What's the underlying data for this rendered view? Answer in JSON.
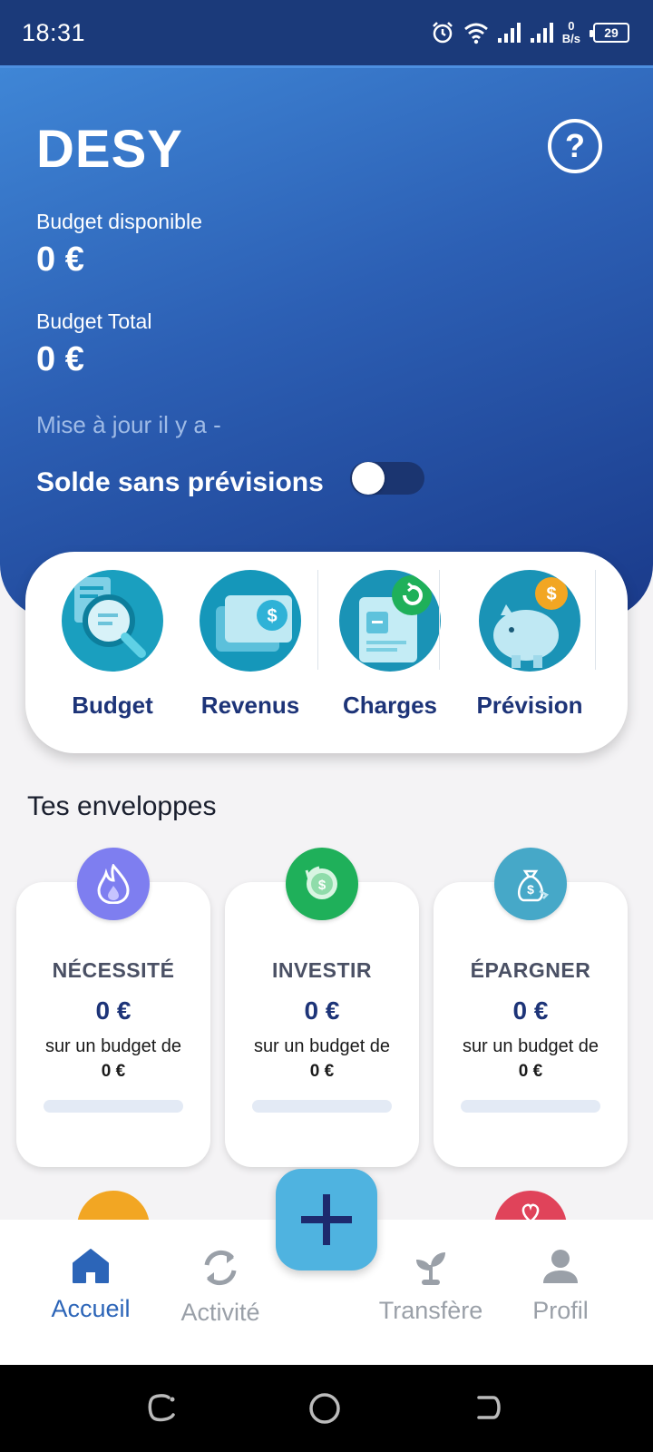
{
  "status_bar": {
    "time": "18:31",
    "net_speed_value": "0",
    "net_speed_unit": "B/s",
    "battery": "29",
    "icons": [
      "alarm-icon",
      "wifi-icon",
      "signal-icon",
      "signal-icon",
      "battery-icon"
    ]
  },
  "header": {
    "user_name": "DESY",
    "help_label": "?",
    "available_label": "Budget disponible",
    "available_value": "0 €",
    "total_label": "Budget Total",
    "total_value": "0 €",
    "update_text": "Mise à jour il y a -",
    "toggle_label": "Solde sans prévisions",
    "toggle_on": false
  },
  "quick_actions": [
    {
      "label": "Budget",
      "icon": "budget-search-icon"
    },
    {
      "label": "Revenus",
      "icon": "income-money-icon"
    },
    {
      "label": "Charges",
      "icon": "charges-document-icon"
    },
    {
      "label": "Prévision",
      "icon": "piggy-bank-icon"
    }
  ],
  "envelopes": {
    "title": "Tes enveloppes",
    "items": [
      {
        "name": "NÉCESSITÉ",
        "amount": "0 €",
        "subtitle": "sur un budget de",
        "budget": "0 €",
        "progress": 0,
        "color": "#7e7ef0",
        "icon": "flame-icon"
      },
      {
        "name": "INVESTIR",
        "amount": "0 €",
        "subtitle": "sur un budget de",
        "budget": "0 €",
        "progress": 0,
        "color": "#1fb05a",
        "icon": "coin-refresh-icon"
      },
      {
        "name": "ÉPARGNER",
        "amount": "0 €",
        "subtitle": "sur un budget de",
        "budget": "0 €",
        "progress": 0,
        "color": "#46a8c8",
        "icon": "money-bag-icon"
      }
    ]
  },
  "bottom_nav": {
    "items": [
      {
        "label": "Accueil",
        "icon": "home-icon",
        "active": true
      },
      {
        "label": "Activité",
        "icon": "sync-icon",
        "active": false
      },
      {
        "label": "Transfère",
        "icon": "sprout-icon",
        "active": false
      },
      {
        "label": "Profil",
        "icon": "person-icon",
        "active": false
      }
    ],
    "fab_icon": "plus-icon"
  },
  "colors": {
    "primary_dark": "#1d3478",
    "header_gradient_start": "#3f86d6",
    "header_gradient_end": "#1a3a8a",
    "fab": "#4fb3e0",
    "nav_active": "#2c65b8",
    "nav_inactive": "#9aa0a8"
  }
}
